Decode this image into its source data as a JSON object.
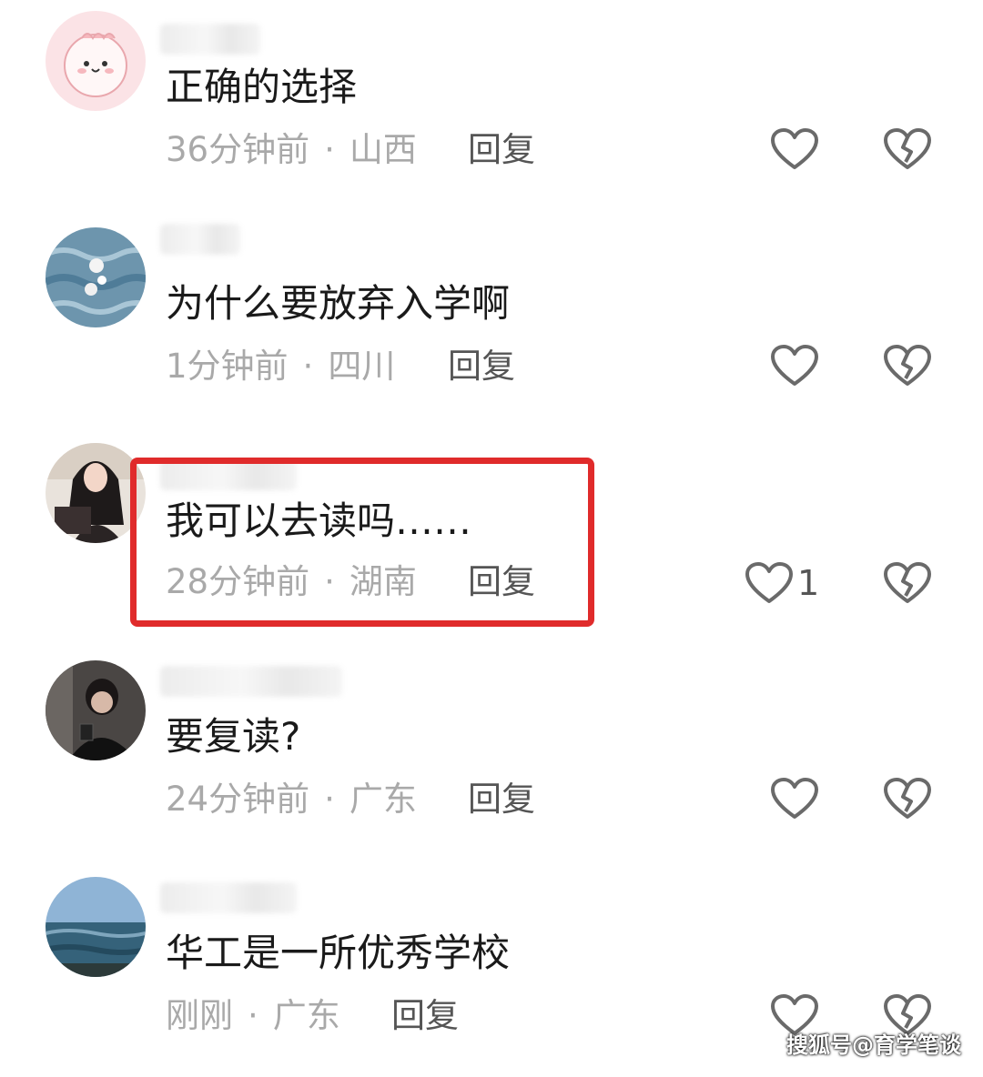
{
  "comments": [
    {
      "text": "正确的选择",
      "time": "36分钟前",
      "separator": "·",
      "location": "山西",
      "reply_label": "回复",
      "like_count": "",
      "avatar": "pink-dino-cartoon-avatar"
    },
    {
      "text": "为什么要放弃入学啊",
      "time": "1分钟前",
      "separator": "·",
      "location": "四川",
      "reply_label": "回复",
      "like_count": "",
      "avatar": "blue-water-flower-avatar"
    },
    {
      "text": "我可以去读吗……",
      "time": "28分钟前",
      "separator": "·",
      "location": "湖南",
      "reply_label": "回复",
      "like_count": "1",
      "avatar": "girl-photo-avatar"
    },
    {
      "text": "要复读?",
      "time": "24分钟前",
      "separator": "·",
      "location": "广东",
      "reply_label": "回复",
      "like_count": "",
      "avatar": "boy-photo-avatar"
    },
    {
      "text": "华工是一所优秀学校",
      "time": "刚刚",
      "separator": "·",
      "location": "广东",
      "reply_label": "回复",
      "like_count": "",
      "avatar": "sea-landscape-avatar"
    }
  ],
  "watermark": "搜狐号@育学笔谈",
  "colors": {
    "highlight_border": "#e02b2b",
    "meta_text": "#a9a9a9",
    "icon_stroke": "#6a6a6a"
  }
}
